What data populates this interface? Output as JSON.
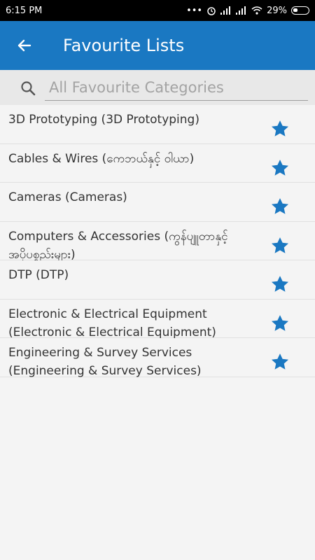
{
  "status_bar": {
    "time": "6:15 PM",
    "battery": "29%"
  },
  "app_bar": {
    "title": "Favourite Lists"
  },
  "search": {
    "placeholder": "All Favourite Categories",
    "value": ""
  },
  "colors": {
    "primary": "#1a78c2",
    "star": "#1a78c2"
  },
  "categories": [
    {
      "label": "3D Prototyping (3D Prototyping)",
      "favourite": true
    },
    {
      "label": "Cables & Wires (ကေဘယ်နှင့် ဝါယာ)",
      "favourite": true
    },
    {
      "label": "Cameras (Cameras)",
      "favourite": true
    },
    {
      "label": "Computers & Accessories (ကွန်ပျူတာနှင့် အပိုပစ္စည်းများ)",
      "favourite": true
    },
    {
      "label": "DTP (DTP)",
      "favourite": true
    },
    {
      "label": "Electronic & Electrical Equipment (Electronic & Electrical Equipment)",
      "favourite": true
    },
    {
      "label": "Engineering & Survey Services (Engineering & Survey Services)",
      "favourite": true
    }
  ]
}
